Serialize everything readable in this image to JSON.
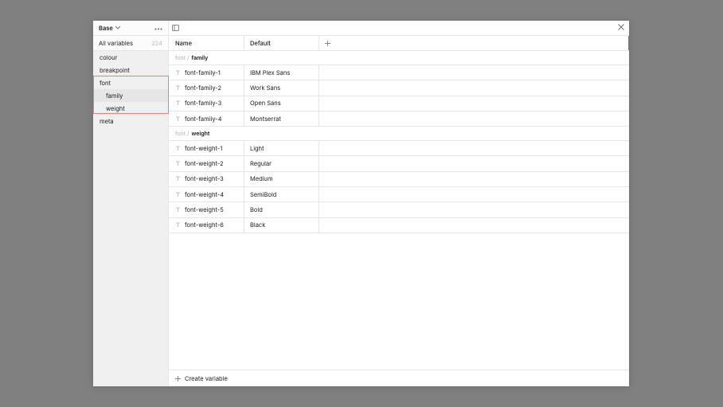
{
  "collection": {
    "name": "Base"
  },
  "allVariables": {
    "label": "All variables",
    "count": "224"
  },
  "groups": [
    {
      "label": "colour"
    },
    {
      "label": "breakpoint"
    },
    {
      "label": "font",
      "selected": true,
      "children": [
        {
          "label": "family",
          "selected": true
        },
        {
          "label": "weight"
        }
      ]
    },
    {
      "label": "meta"
    }
  ],
  "columns": {
    "name": "Name",
    "default": "Default"
  },
  "sections": [
    {
      "prefix": "font /",
      "group": "family",
      "rows": [
        {
          "name": "font-family-1",
          "value": "IBM Plex Sans"
        },
        {
          "name": "font-family-2",
          "value": "Work Sans"
        },
        {
          "name": "font-family-3",
          "value": "Open Sans"
        },
        {
          "name": "font-family-4",
          "value": "Montserrat"
        }
      ]
    },
    {
      "prefix": "font /",
      "group": "weight",
      "rows": [
        {
          "name": "font-weight-1",
          "value": "Light"
        },
        {
          "name": "font-weight-2",
          "value": "Regular"
        },
        {
          "name": "font-weight-3",
          "value": "Medium"
        },
        {
          "name": "font-weight-4",
          "value": "SemiBold"
        },
        {
          "name": "font-weight-5",
          "value": "Bold"
        },
        {
          "name": "font-weight-6",
          "value": "Black"
        }
      ]
    }
  ],
  "footer": {
    "createVariable": "Create variable"
  }
}
